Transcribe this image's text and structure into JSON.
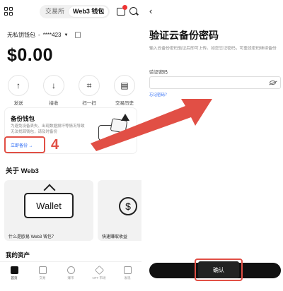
{
  "left": {
    "header": {
      "tabs": [
        "交易所",
        "Web3 钱包"
      ],
      "active_tab_index": 1
    },
    "account": {
      "name": "无私钥钱包",
      "masked": "****423"
    },
    "balance": "$0.00",
    "actions": [
      {
        "label": "发送",
        "icon": "arrow-up-icon"
      },
      {
        "label": "接收",
        "icon": "arrow-down-icon"
      },
      {
        "label": "扫一扫",
        "icon": "scan-icon"
      },
      {
        "label": "交易历史",
        "icon": "history-icon"
      }
    ],
    "backup_card": {
      "title": "备份钱包",
      "desc": "为避免设备丢失、出现数据损坏等情况导致无法找回钱包，请及时备份",
      "button": "立即备份 →"
    },
    "step_number": "4",
    "about_heading": "关于 Web3",
    "promos": [
      {
        "image_text": "Wallet",
        "caption": "什么是欧易 Web3 钱包？"
      },
      {
        "image_text": "$",
        "caption": "快速赚取收益"
      }
    ],
    "my_assets": "我的资产",
    "tabbar": [
      "首页",
      "交易",
      "赚币",
      "NFT 市场",
      "发现"
    ],
    "tabbar_active_index": 0
  },
  "right": {
    "back": "‹",
    "title": "验证云备份密码",
    "desc": "输入云备份密码验证后即可上传。如您忘记密码，可重设密码继续备份",
    "field_label": "验证密码",
    "field_value": "",
    "forgot": "忘记密码？",
    "confirm": "确认"
  },
  "colors": {
    "annotation_red": "#e14f45",
    "link_blue": "#2f6df6",
    "confirm_bg": "#111111"
  }
}
